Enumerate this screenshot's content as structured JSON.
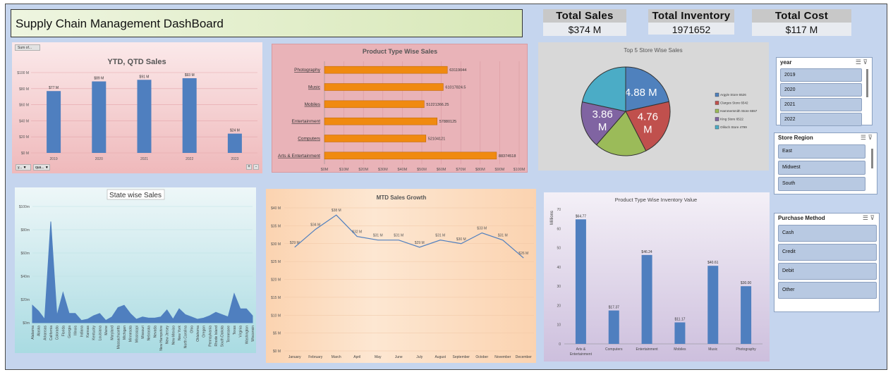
{
  "dashboard": {
    "title": "Supply Chain Management DashBoard"
  },
  "kpis": [
    {
      "label": "Total Sales",
      "value": "$374 M"
    },
    {
      "label": "Total Inventory",
      "value": "1971652"
    },
    {
      "label": "Total Cost",
      "value": "$117 M"
    }
  ],
  "ytd_panel": {
    "field_button": "Sum of...",
    "filter_year": "y...",
    "filter_quarter": "qua...",
    "zoom_plus": "+",
    "zoom_minus": "-"
  },
  "slicers": {
    "year": {
      "header": "year",
      "items": [
        "2019",
        "2020",
        "2021",
        "2022"
      ]
    },
    "region": {
      "header": "Store Region",
      "items": [
        "East",
        "Midwest",
        "South"
      ]
    },
    "purchase": {
      "header": "Purchase Method",
      "items": [
        "Cash",
        "Credit",
        "Debit",
        "Other"
      ]
    }
  },
  "colors": {
    "bar_blue": "#4f7fbf",
    "bar_orange": "#f08a10",
    "pie1": "#4f81bd",
    "pie2": "#c0504d",
    "pie3": "#9bbb59",
    "pie4": "#8064a2",
    "pie5": "#4bacc6"
  },
  "chart_data": [
    {
      "type": "bar",
      "title": "YTD, QTD Sales",
      "categories": [
        "2019",
        "2020",
        "2021",
        "2022",
        "2023"
      ],
      "values": [
        77,
        89,
        91,
        93,
        24
      ],
      "data_labels": [
        "$77 M",
        "$89 M",
        "$91 M",
        "$93 M",
        "$24 M"
      ],
      "y_ticks": [
        "$0 M",
        "$20 M",
        "$40 M",
        "$60 M",
        "$80 M",
        "$100 M"
      ],
      "ylim": [
        0,
        100
      ]
    },
    {
      "type": "bar",
      "orientation": "horizontal",
      "title": "Product Type Wise Sales",
      "categories": [
        "Photography",
        "Music",
        "Mobiles",
        "Entertainment",
        "Computers",
        "Arts & Entertainment"
      ],
      "values": [
        63119044,
        61017824.5,
        51221366.25,
        57880125,
        52104121,
        88374518
      ],
      "data_labels": [
        "63119044",
        "61017824.5",
        "51221366.25",
        "57880125",
        "52104121",
        "88374518"
      ],
      "x_ticks": [
        "$0M",
        "$10M",
        "$20M",
        "$30M",
        "$40M",
        "$50M",
        "$60M",
        "$70M",
        "$80M",
        "$90M",
        "$100M"
      ],
      "xlim": [
        0,
        100000000
      ]
    },
    {
      "type": "pie",
      "title": "Top 5 Store Wise Sales",
      "labels": [
        "Argyle Store 6526",
        "Clarges Store 6542",
        "Hammersmith Store 6557",
        "King Store 6522",
        "Oliloch Store 4799"
      ],
      "values": [
        4.88,
        4.76,
        4.3,
        3.86,
        4.9
      ],
      "slice_labels": [
        "4.88 M",
        "4.76 M",
        "",
        "3.86 M",
        ""
      ]
    },
    {
      "type": "area",
      "title": "State wise Sales",
      "categories": [
        "Alabama",
        "Alaska",
        "Arkansas",
        "California",
        "Colorado",
        "Florida",
        "Georgia",
        "Illinois",
        "Indiana",
        "Kansas",
        "Kentucky",
        "Louisiana",
        "Maine",
        "Maryland",
        "Massachusetts",
        "Michigan",
        "Minnesota",
        "Mississippi",
        "Missouri",
        "Nebraska",
        "Nevada",
        "New Hampshire",
        "New Jersey",
        "New Mexico",
        "New York",
        "North Carolina",
        "Ohio",
        "Oklahoma",
        "Oregon",
        "Pennsylvania",
        "Rhode Island",
        "South Dakota",
        "Tennessee",
        "Texas",
        "Virginia",
        "Washington",
        "Wisconsin"
      ],
      "values": [
        15,
        10,
        3,
        87,
        6,
        26,
        8,
        8,
        2,
        3,
        6,
        8,
        2,
        5,
        13,
        15,
        8,
        3,
        5,
        4,
        4,
        5,
        11,
        3,
        12,
        7,
        5,
        3,
        4,
        6,
        9,
        7,
        5,
        25,
        12,
        12,
        6
      ],
      "y_ticks": [
        "$0m",
        "$20m",
        "$40m",
        "$60m",
        "$80m",
        "$100m"
      ],
      "ylim": [
        0,
        100
      ]
    },
    {
      "type": "line",
      "title": "MTD Sales Growth",
      "categories": [
        "January",
        "February",
        "March",
        "April",
        "May",
        "June",
        "July",
        "August",
        "September",
        "October",
        "November",
        "December"
      ],
      "values": [
        29,
        34,
        38,
        32,
        31,
        31,
        29,
        31,
        30,
        33,
        31,
        26
      ],
      "data_labels": [
        "$29 M",
        "$34 M",
        "$38 M",
        "$32 M",
        "$31 M",
        "$31 M",
        "$29 M",
        "$31 M",
        "$30 M",
        "$33 M",
        "$31 M",
        "$26 M"
      ],
      "y_ticks": [
        "$0 M",
        "$5 M",
        "$10 M",
        "$15 M",
        "$20 M",
        "$25 M",
        "$30 M",
        "$35 M",
        "$40 M"
      ],
      "ylim": [
        0,
        40
      ]
    },
    {
      "type": "bar",
      "title": "Product Type Wise Inventory Value",
      "ylabel": "Millions",
      "categories": [
        "Arts & Entertainment",
        "Computers",
        "Entertainment",
        "Mobiles",
        "Music",
        "Photography"
      ],
      "category_lines": [
        [
          "Arts &",
          "Entertainment"
        ],
        [
          "Computers"
        ],
        [
          "Entertainment"
        ],
        [
          "Mobiles"
        ],
        [
          "Music"
        ],
        [
          "Photography"
        ]
      ],
      "values": [
        64.77,
        17.37,
        46.24,
        11.17,
        40.61,
        30.0
      ],
      "data_labels": [
        "$64.77",
        "$17.37",
        "$46.24",
        "$11.17",
        "$40.61",
        "$30.00"
      ],
      "y_ticks": [
        "0",
        "10",
        "20",
        "30",
        "40",
        "50",
        "60",
        "70"
      ],
      "ylim": [
        0,
        70
      ]
    }
  ]
}
